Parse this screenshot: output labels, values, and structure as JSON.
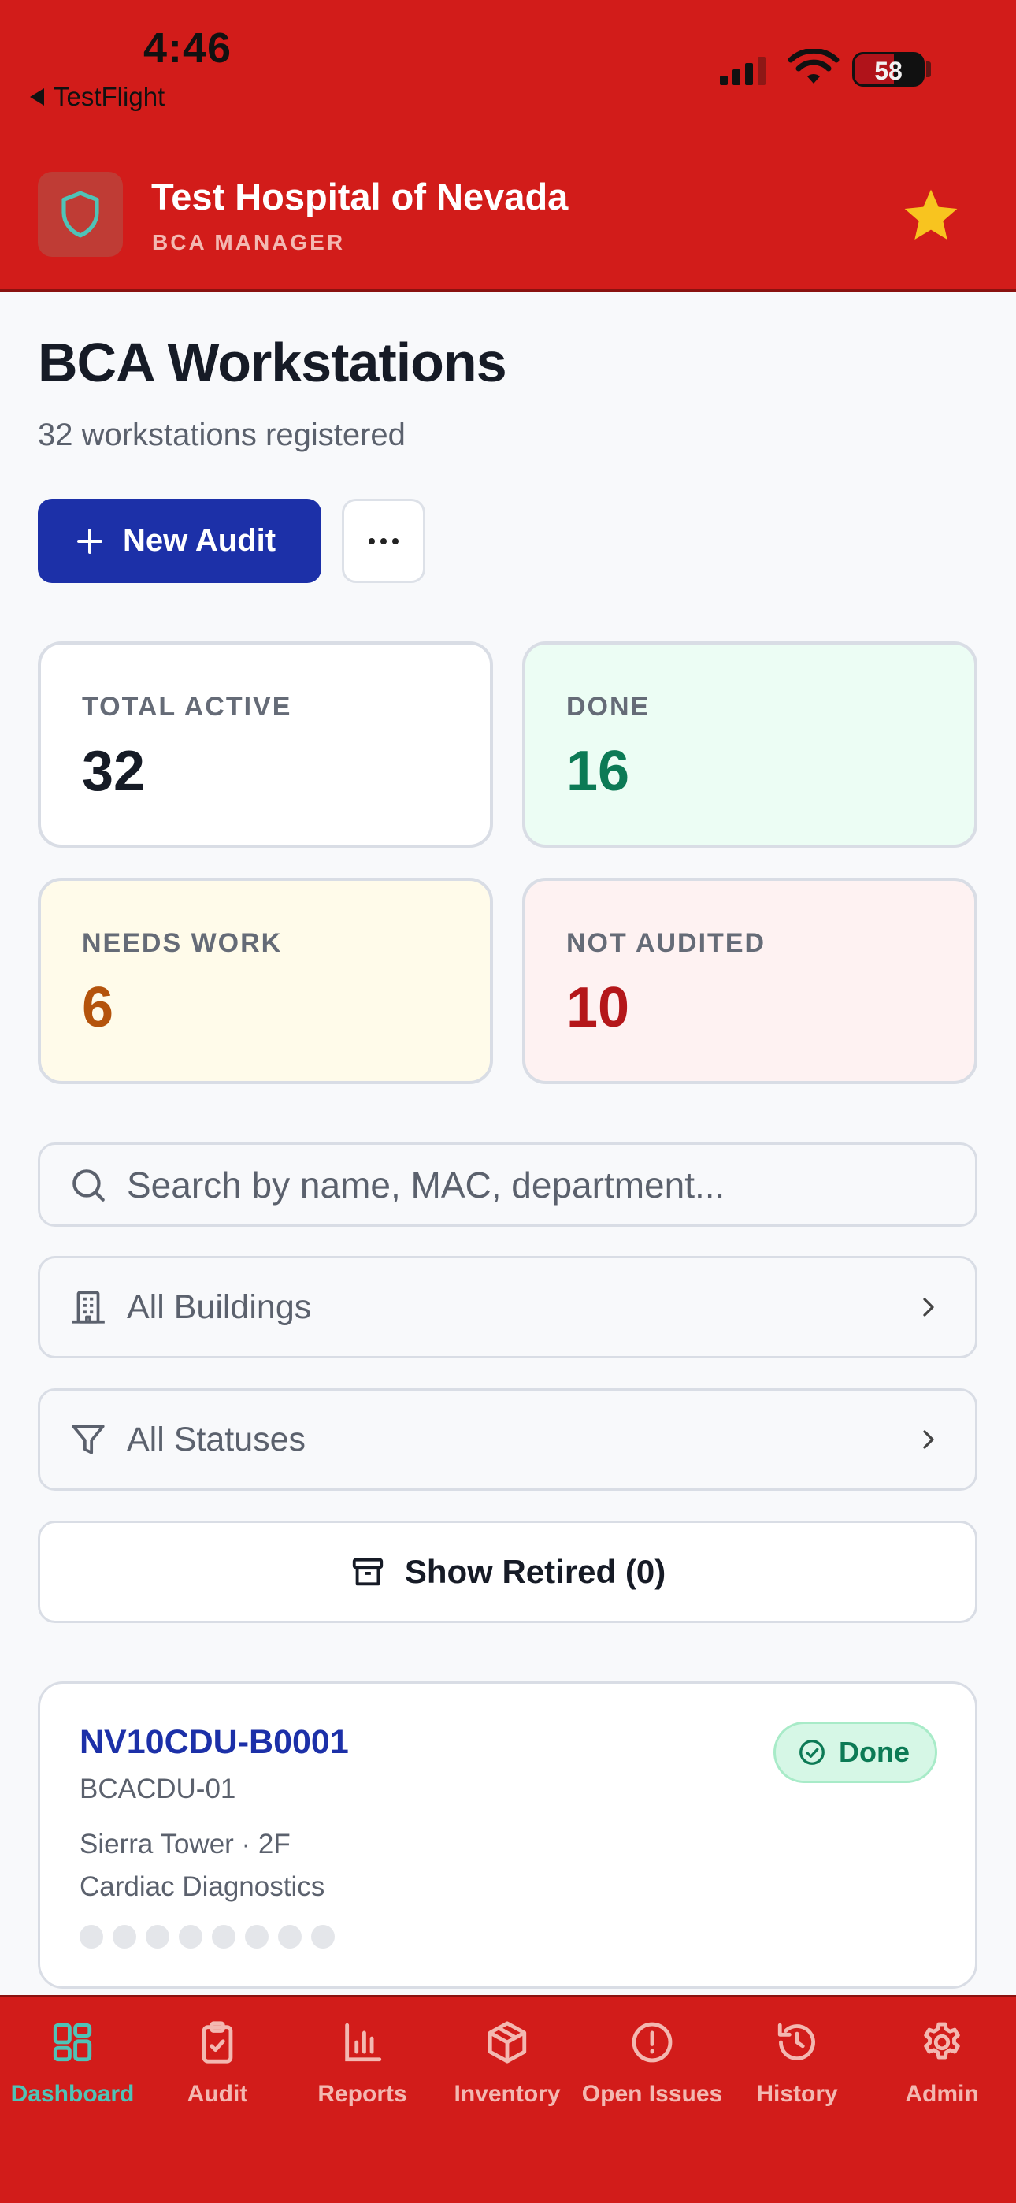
{
  "status_bar": {
    "time": "4:46",
    "back_label": "TestFlight",
    "battery_level": "58"
  },
  "header": {
    "title": "Test Hospital of Nevada",
    "subtitle": "BCA MANAGER",
    "logo_icon": "shield-icon",
    "action_icon": "star-icon",
    "color": "#d21c1a"
  },
  "main": {
    "title": "BCA Workstations",
    "subtitle": "32 workstations registered",
    "new_audit_label": "New Audit",
    "more_icon": "ellipsis-icon"
  },
  "stats": [
    {
      "label": "TOTAL ACTIVE",
      "value": "32"
    },
    {
      "label": "DONE",
      "value": "16"
    },
    {
      "label": "NEEDS WORK",
      "value": "6"
    },
    {
      "label": "NOT AUDITED",
      "value": "10"
    }
  ],
  "filters": {
    "search_placeholder": "Search by name, MAC, department...",
    "building_value": "All Buildings",
    "status_value": "All Statuses",
    "retired_label": "Show Retired (0)"
  },
  "workstations": [
    {
      "id": "NV10CDU-B0001",
      "tag": "BCACDU-01",
      "location": "Sierra Tower · 2F",
      "department": "Cardiac Diagnostics",
      "status": "Done",
      "checks_completed": 0,
      "checks_total": 8
    }
  ],
  "tabs": [
    {
      "label": "Dashboard",
      "icon": "dashboard-icon",
      "active": true
    },
    {
      "label": "Audit",
      "icon": "clipboard-check-icon",
      "active": false
    },
    {
      "label": "Reports",
      "icon": "bar-chart-icon",
      "active": false
    },
    {
      "label": "Inventory",
      "icon": "package-icon",
      "active": false
    },
    {
      "label": "Open Issues",
      "icon": "alert-circle-icon",
      "active": false
    },
    {
      "label": "History",
      "icon": "history-icon",
      "active": false
    },
    {
      "label": "Admin",
      "icon": "gear-icon",
      "active": false
    }
  ]
}
